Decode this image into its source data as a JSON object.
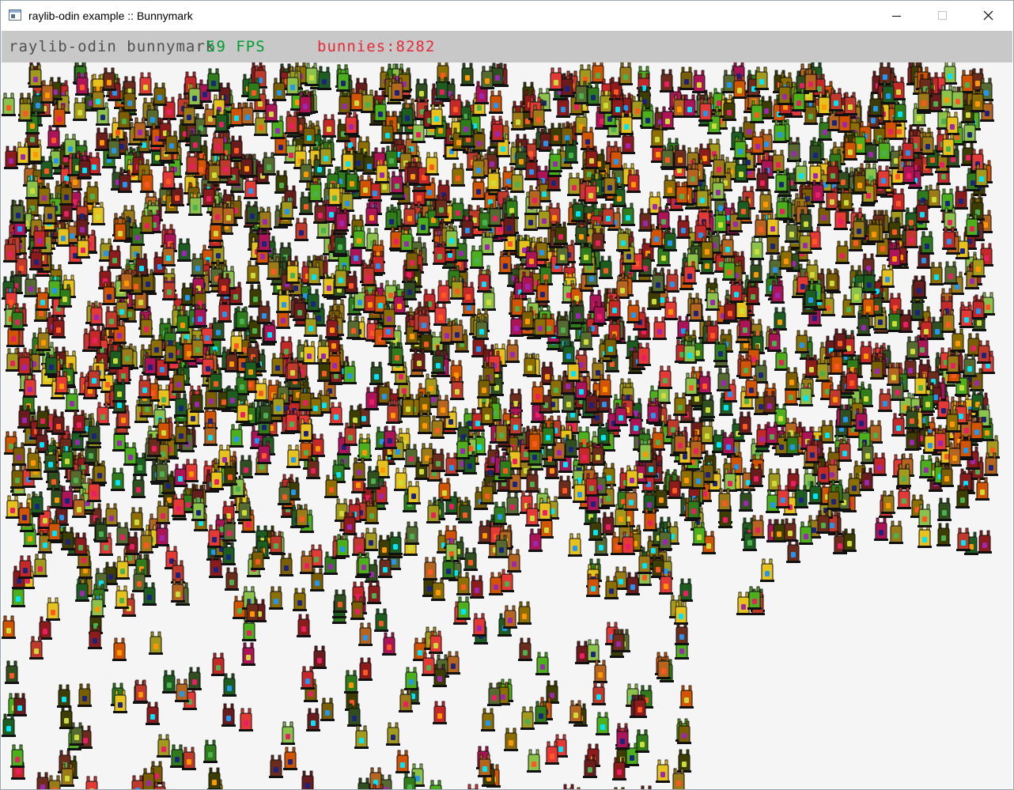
{
  "window": {
    "title": "raylib-odin example :: Bunnymark",
    "icon": "app-window-icon",
    "controls": [
      "minimize-icon",
      "maximize-icon",
      "close-icon"
    ]
  },
  "hud": {
    "title": "raylib-odin bunnymark",
    "fps": "59 FPS",
    "bunnies_label": "bunnies:",
    "bunnies_count": "8282",
    "colors": {
      "bar": "#c8c8c8",
      "title": "#505050",
      "fps": "#009e2f",
      "bunnies": "#e62937"
    }
  },
  "scene": {
    "background": "#f5f5f5",
    "sprite": "bunny",
    "bunny_count": 8282
  }
}
